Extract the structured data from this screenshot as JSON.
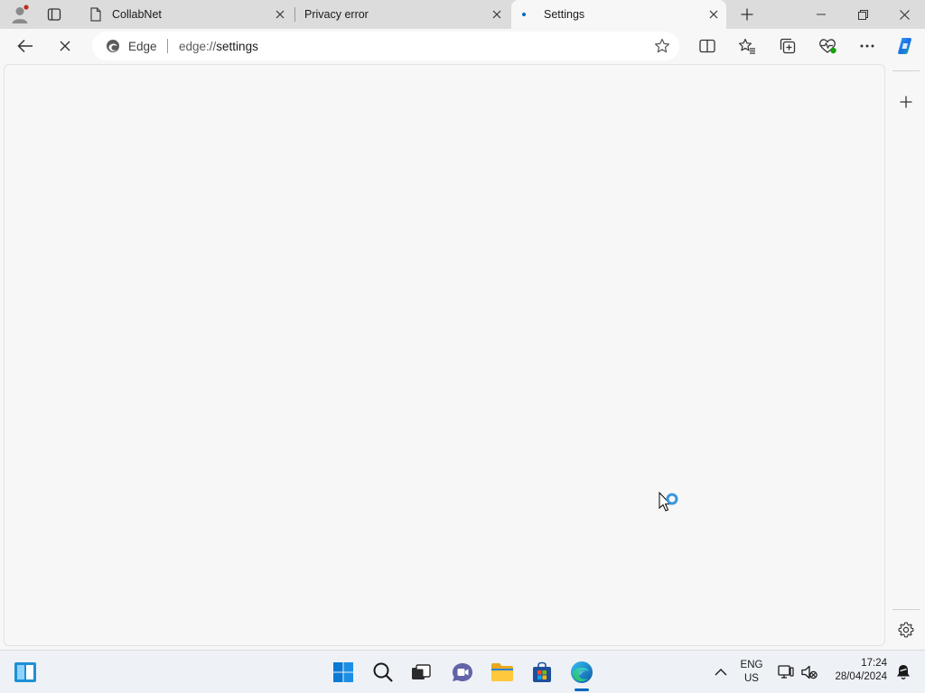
{
  "browser": {
    "tabs": [
      {
        "label": "CollabNet",
        "icon": "page-icon",
        "active": false
      },
      {
        "label": "Privacy error",
        "icon": "none",
        "active": false
      },
      {
        "label": "Settings",
        "icon": "loading-dot-icon",
        "active": true
      }
    ],
    "address_bar": {
      "site_label": "Edge",
      "url_scheme": "edge://",
      "url_path": "settings"
    },
    "colors": {
      "accent": "#0067c0",
      "tab_bar": "#dcdcdc",
      "content_bg": "#f7f7f7"
    }
  },
  "taskbar": {
    "language": {
      "line1": "ENG",
      "line2": "US"
    },
    "clock": {
      "time": "17:24",
      "date": "28/04/2024"
    }
  }
}
